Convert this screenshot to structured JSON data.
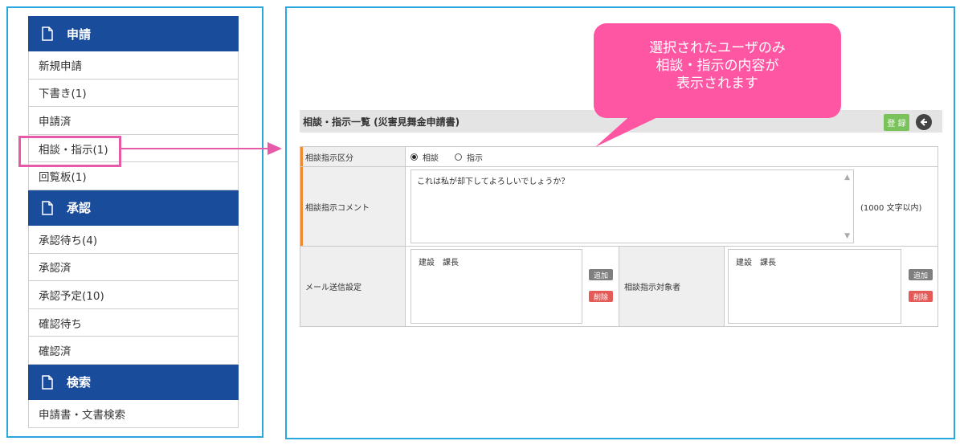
{
  "sidebar": {
    "sections": [
      {
        "title": "申請",
        "items": [
          "新規申請",
          "下書き(1)",
          "申請済",
          "相談・指示(1)",
          "回覧板(1)"
        ]
      },
      {
        "title": "承認",
        "items": [
          "承認待ち(4)",
          "承認済",
          "承認予定(10)",
          "確認待ち",
          "確認済"
        ]
      },
      {
        "title": "検索",
        "items": [
          "申請書・文書検索"
        ]
      }
    ]
  },
  "callout": {
    "line1": "選択されたユーザのみ",
    "line2": "相談・指示の内容が",
    "line3": "表示されます"
  },
  "panel": {
    "title": "相談・指示一覧 (災害見舞金申請書)",
    "register_label": "登 録"
  },
  "form": {
    "type_label": "相談指示区分",
    "type_options": [
      "相談",
      "指示"
    ],
    "type_selected": "相談",
    "comment_label": "相談指示コメント",
    "comment_value": "これは私が却下してよろしいでしょうか？",
    "comment_limit": "(1000 文字以内)",
    "mail_label": "メール送信設定",
    "mail_list": [
      "建設　課長"
    ],
    "target_label": "相談指示対象者",
    "target_list": [
      "建設　課長"
    ],
    "add_label": "追加",
    "delete_label": "削除"
  },
  "colors": {
    "header_blue": "#1a4c9c",
    "frame_blue": "#29a8e0",
    "highlight_pink": "#e65aa8",
    "callout_pink": "#ff56a3",
    "register_green": "#7ac35a",
    "delete_red": "#e35a57",
    "label_accent_orange": "#f08a2c"
  }
}
